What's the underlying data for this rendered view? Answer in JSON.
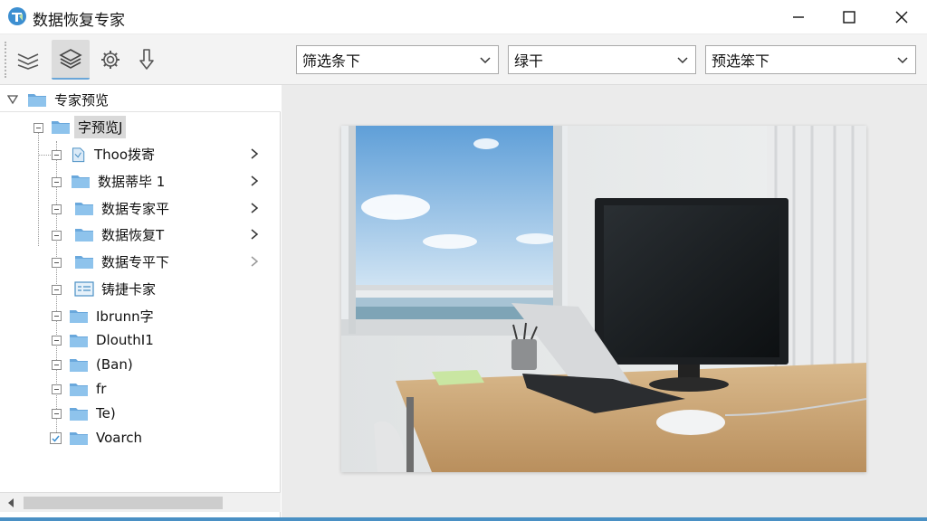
{
  "window": {
    "title": "数据恢复专家"
  },
  "toolbar": {
    "combo1": "筛选条下",
    "combo2": "绿干",
    "combo3": "预选笨下"
  },
  "tree": {
    "root": "专家预览",
    "child": "字预览J",
    "items": [
      {
        "label": "Thoo拨寄",
        "icon": "doc-icon",
        "arrow": true
      },
      {
        "label": "数据蒂毕 1",
        "icon": "folder-icon",
        "arrow": true
      },
      {
        "label": "数据专家平",
        "icon": "folder-icon",
        "arrow": true
      },
      {
        "label": "数据恢复T",
        "icon": "folder-icon",
        "arrow": true
      },
      {
        "label": "数据专平下",
        "icon": "folder-icon",
        "arrow": true
      },
      {
        "label": "铸捷卡家",
        "icon": "list-icon",
        "arrow": false
      }
    ],
    "lower_items": [
      {
        "label": "Ibrunn字"
      },
      {
        "label": "DlouthI1"
      },
      {
        "label": "(Ban)"
      },
      {
        "label": "fr"
      },
      {
        "label": "Te)"
      },
      {
        "label": "Voarch"
      }
    ]
  },
  "colors": {
    "accent": "#4a90c4",
    "folder": "#8ec3ec",
    "folder_tab": "#6aa8dc"
  }
}
